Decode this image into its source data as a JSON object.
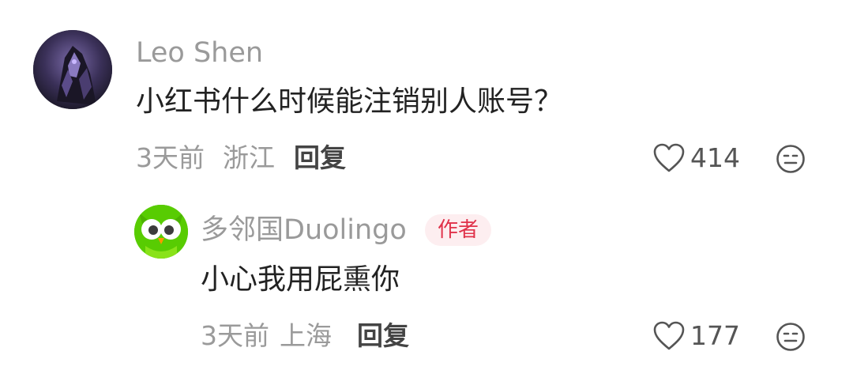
{
  "comments": [
    {
      "username": "Leo Shen",
      "text": "小红书什么时候能注销别人账号？",
      "time": "3天前",
      "location": "浙江",
      "reply_label": "回复",
      "likes": "414",
      "avatar_icon": "dark-robot-avatar"
    }
  ],
  "replies": [
    {
      "username": "多邻国Duolingo",
      "author_badge": "作者",
      "text": "小心我用屁熏你",
      "time": "3天前",
      "location": "上海",
      "reply_label": "回复",
      "likes": "177",
      "avatar_icon": "duolingo-owl-avatar"
    }
  ],
  "icons": {
    "like": "heart-outline-icon",
    "emoji": "neutral-face-icon"
  },
  "colors": {
    "badge_bg": "#fdeef0",
    "badge_text": "#e0324a",
    "duolingo_green": "#58cc02"
  }
}
